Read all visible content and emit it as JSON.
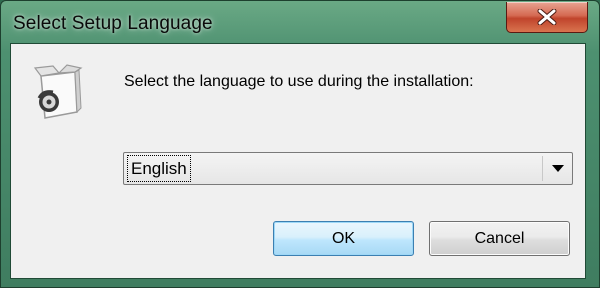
{
  "window": {
    "title": "Select Setup Language",
    "close_icon": "close-x-icon"
  },
  "dialog": {
    "icon": "setup-box-icon",
    "prompt": "Select the language to use during the installation:",
    "language_select": {
      "selected": "English",
      "arrow_icon": "chevron-down-icon"
    },
    "ok_label": "OK",
    "cancel_label": "Cancel"
  },
  "colors": {
    "frame": "#3f7d60",
    "client_bg": "#f0f0f0",
    "close_button": "#c0442c",
    "ok_button": "#bee6fd"
  }
}
